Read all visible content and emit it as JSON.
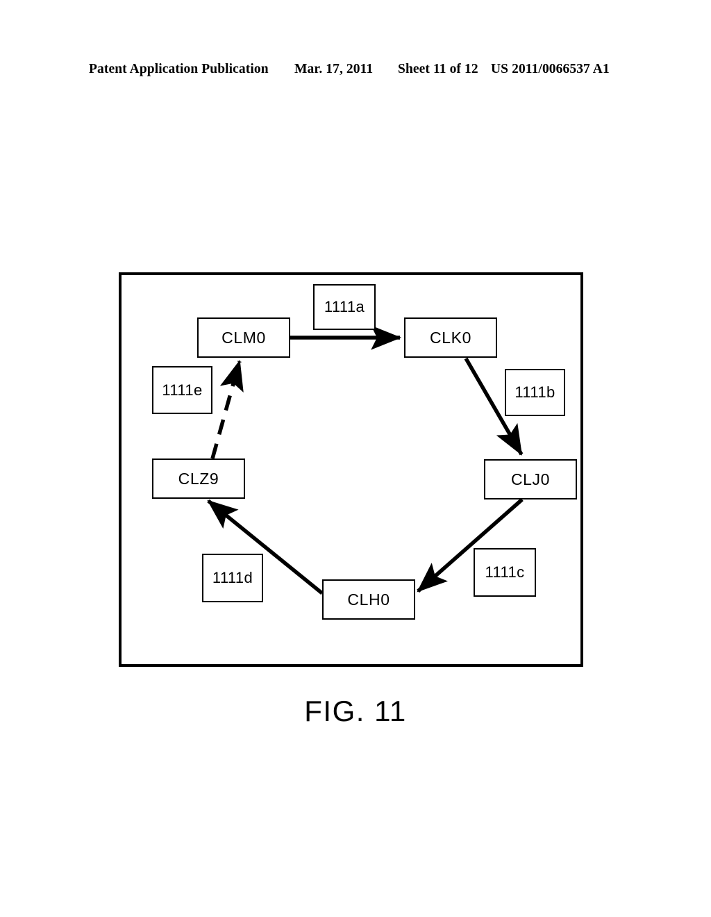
{
  "header": {
    "publication": "Patent Application Publication",
    "date": "Mar. 17, 2011",
    "sheet": "Sheet 11 of 12",
    "document_number": "US 2011/0066537 A1"
  },
  "figure": {
    "caption": "FIG. 11",
    "nodes": [
      {
        "id": "clm0",
        "label": "CLM0"
      },
      {
        "id": "clk0",
        "label": "CLK0"
      },
      {
        "id": "clj0",
        "label": "CLJ0"
      },
      {
        "id": "clh0",
        "label": "CLH0"
      },
      {
        "id": "clz9",
        "label": "CLZ9"
      }
    ],
    "ref_labels": [
      {
        "id": "1111a",
        "label": "1111a"
      },
      {
        "id": "1111b",
        "label": "1111b"
      },
      {
        "id": "1111c",
        "label": "1111c"
      },
      {
        "id": "1111d",
        "label": "1111d"
      },
      {
        "id": "1111e",
        "label": "1111e"
      }
    ],
    "edges": [
      {
        "id": "1111a",
        "from": "CLM0",
        "to": "CLK0",
        "style": "solid"
      },
      {
        "id": "1111b",
        "from": "CLK0",
        "to": "CLJ0",
        "style": "solid"
      },
      {
        "id": "1111c",
        "from": "CLJ0",
        "to": "CLH0",
        "style": "solid"
      },
      {
        "id": "1111d",
        "from": "CLH0",
        "to": "CLZ9",
        "style": "solid"
      },
      {
        "id": "1111e",
        "from": "CLZ9",
        "to": "CLM0",
        "style": "dashed"
      }
    ]
  },
  "colors": {
    "ink": "#000000",
    "paper": "#ffffff"
  }
}
